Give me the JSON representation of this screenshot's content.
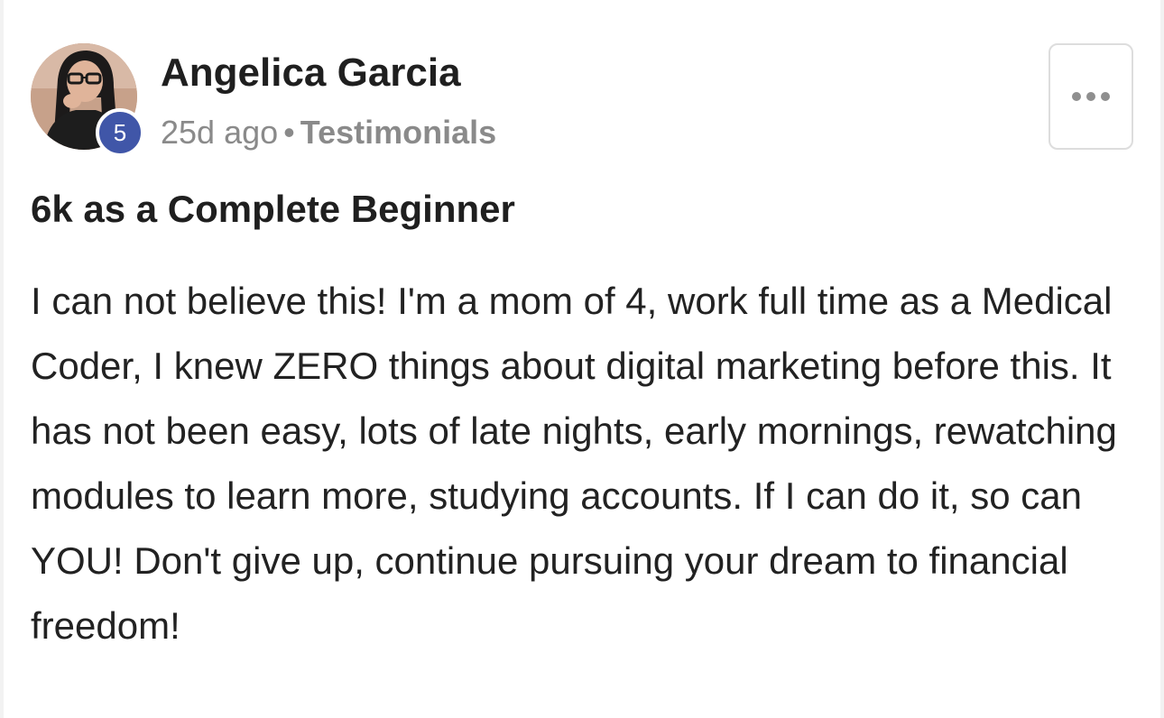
{
  "post": {
    "author": {
      "name": "Angelica Garcia",
      "level": "5"
    },
    "time_ago": "25d ago",
    "separator": "•",
    "category": "Testimonials",
    "title": "6k as a Complete Beginner",
    "body": "I can not believe this! I'm a mom of 4, work full time as a Medical Coder, I knew ZERO things about digital marketing before this. It has not been easy, lots of late nights, early mornings, rewatching modules to learn more, studying accounts. If I can do it, so can YOU! Don't give up, continue pursuing your dream to financial freedom!",
    "menu_icon": "more-horizontal-icon"
  },
  "colors": {
    "badge": "#4056a8",
    "meta_text": "#8a8a8a",
    "title_text": "#1f1f1f"
  }
}
